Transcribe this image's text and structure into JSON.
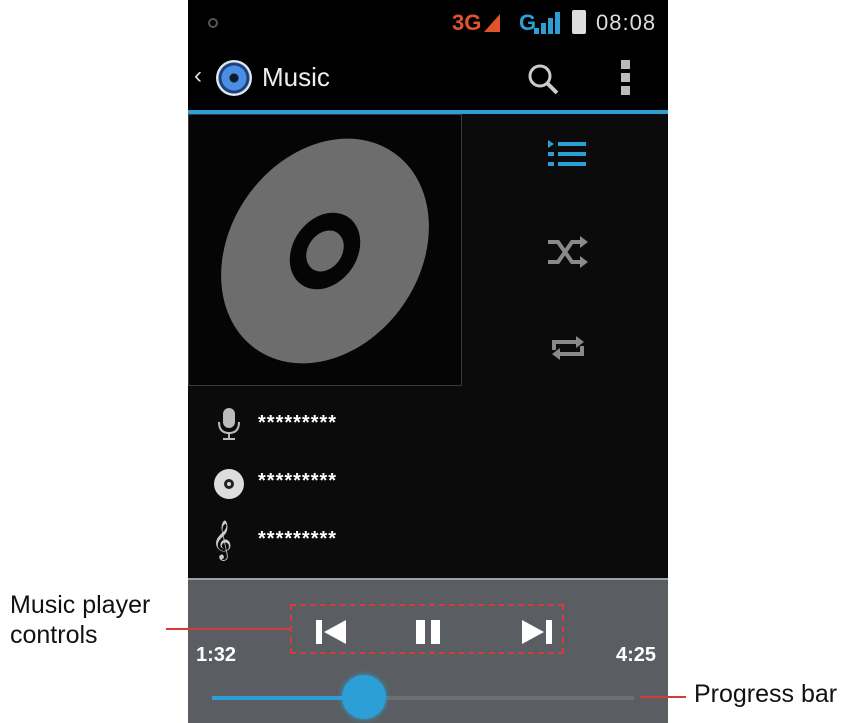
{
  "status_bar": {
    "network_primary": "3G",
    "network_secondary": "G",
    "time": "08:08"
  },
  "action_bar": {
    "title": "Music",
    "back_icon": "chevron-left-icon",
    "app_icon": "music-disc-icon",
    "search_icon": "search-icon",
    "menu_icon": "overflow-menu-icon"
  },
  "side_controls": {
    "now_playing_list_icon": "list-icon",
    "shuffle_icon": "shuffle-icon",
    "repeat_icon": "repeat-icon"
  },
  "track_info": {
    "artist": "*********",
    "album": "*********",
    "song": "*********"
  },
  "player": {
    "elapsed": "1:32",
    "duration": "4:25",
    "progress": 0.36,
    "prev_icon": "previous-icon",
    "pause_icon": "pause-icon",
    "next_icon": "next-icon"
  },
  "annotations": {
    "controls_label": "Music player\ncontrols",
    "progress_label": "Progress bar"
  },
  "colors": {
    "accent": "#2c9fd6",
    "callout": "#d43b3b"
  }
}
